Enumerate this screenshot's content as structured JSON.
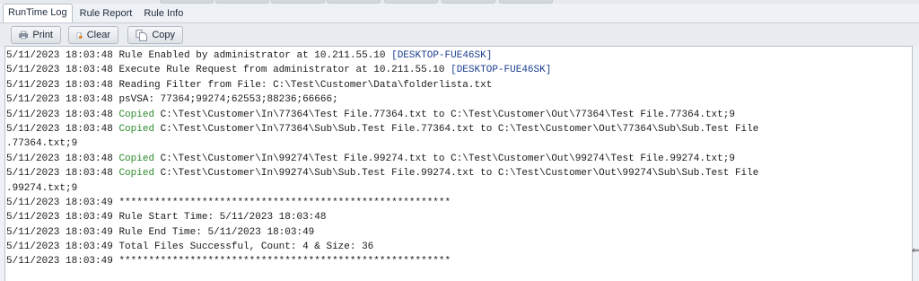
{
  "tabs": [
    {
      "label": "RunTime Log",
      "active": true
    },
    {
      "label": "Rule Report",
      "active": false
    },
    {
      "label": "Rule Info",
      "active": false
    }
  ],
  "toolbar": {
    "print_label": "Print",
    "clear_label": "Clear",
    "copy_label": "Copy"
  },
  "colors": {
    "host": "#1d3f8f",
    "copied": "#2e8b2e"
  },
  "log": [
    {
      "ts": "5/11/2023 18:03:48",
      "msg": "Rule Enabled by administrator at 10.211.55.10",
      "host": "[DESKTOP-FUE46SK]"
    },
    {
      "ts": "5/11/2023 18:03:48",
      "msg": "Execute Rule Request from administrator at 10.211.55.10",
      "host": "[DESKTOP-FUE46SK]"
    },
    {
      "ts": "5/11/2023 18:03:48",
      "msg": "Reading Filter from File: C:\\Test\\Customer\\Data\\folderlista.txt"
    },
    {
      "ts": "5/11/2023 18:03:48",
      "msg": "psVSA: 77364;99274;62553;88236;66666;"
    },
    {
      "ts": "5/11/2023 18:03:48",
      "copied": "Copied",
      "msg": "C:\\Test\\Customer\\In\\77364\\Test File.77364.txt to C:\\Test\\Customer\\Out\\77364\\Test File.77364.txt;9"
    },
    {
      "ts": "5/11/2023 18:03:48",
      "copied": "Copied",
      "msg": "C:\\Test\\Customer\\In\\77364\\Sub\\Sub.Test File.77364.txt to C:\\Test\\Customer\\Out\\77364\\Sub\\Sub.Test File",
      "cont": ".77364.txt;9"
    },
    {
      "ts": "5/11/2023 18:03:48",
      "copied": "Copied",
      "msg": "C:\\Test\\Customer\\In\\99274\\Test File.99274.txt to C:\\Test\\Customer\\Out\\99274\\Test File.99274.txt;9"
    },
    {
      "ts": "5/11/2023 18:03:48",
      "copied": "Copied",
      "msg": "C:\\Test\\Customer\\In\\99274\\Sub\\Sub.Test File.99274.txt to C:\\Test\\Customer\\Out\\99274\\Sub\\Sub.Test File",
      "cont": ".99274.txt;9"
    },
    {
      "ts": "5/11/2023 18:03:49",
      "msg": "********************************************************"
    },
    {
      "ts": "5/11/2023 18:03:49",
      "msg": "Rule Start Time: 5/11/2023 18:03:48"
    },
    {
      "ts": "5/11/2023 18:03:49",
      "msg": "Rule End Time: 5/11/2023 18:03:49"
    },
    {
      "ts": "5/11/2023 18:03:49",
      "msg": "Total Files Successful, Count: 4 & Size: 36"
    },
    {
      "ts": "5/11/2023 18:03:49",
      "msg": "********************************************************"
    }
  ]
}
